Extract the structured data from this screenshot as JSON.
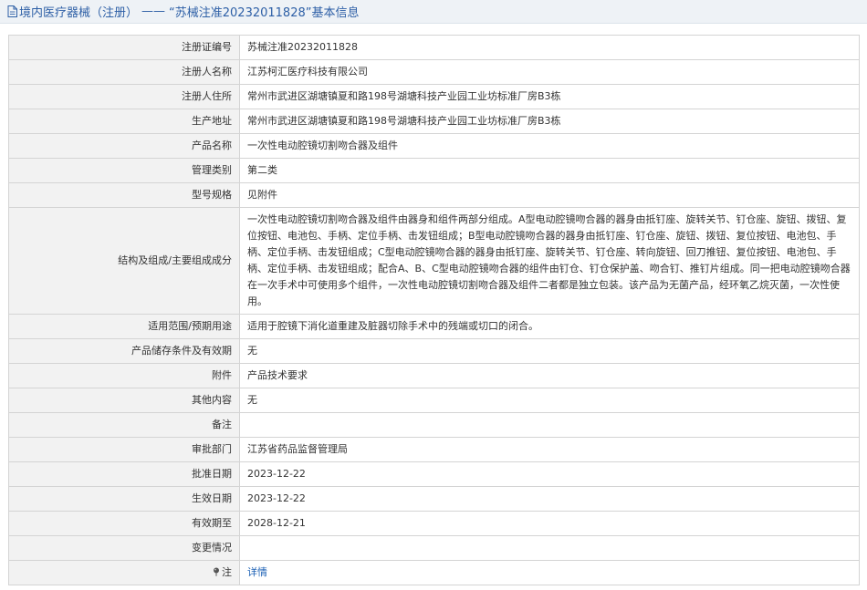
{
  "header": {
    "category": "境内医疗器械（注册）",
    "separator": "——",
    "record_title": "“苏械注准20232011828”基本信息"
  },
  "rows": [
    {
      "label": "注册证编号",
      "value": "苏械注准20232011828"
    },
    {
      "label": "注册人名称",
      "value": "江苏柯汇医疗科技有限公司"
    },
    {
      "label": "注册人住所",
      "value": "常州市武进区湖塘镇夏和路198号湖塘科技产业园工业坊标准厂房B3栋"
    },
    {
      "label": "生产地址",
      "value": "常州市武进区湖塘镇夏和路198号湖塘科技产业园工业坊标准厂房B3栋"
    },
    {
      "label": "产品名称",
      "value": "一次性电动腔镜切割吻合器及组件"
    },
    {
      "label": "管理类别",
      "value": "第二类"
    },
    {
      "label": "型号规格",
      "value": "见附件"
    },
    {
      "label": "结构及组成/主要组成成分",
      "value": "一次性电动腔镜切割吻合器及组件由器身和组件两部分组成。A型电动腔镜吻合器的器身由抵钉座、旋转关节、钉仓座、旋钮、拨钮、复位按钮、电池包、手柄、定位手柄、击发钮组成；B型电动腔镜吻合器的器身由抵钉座、钉仓座、旋钮、拨钮、复位按钮、电池包、手柄、定位手柄、击发钮组成；C型电动腔镜吻合器的器身由抵钉座、旋转关节、钉仓座、转向旋钮、回刀推钮、复位按钮、电池包、手柄、定位手柄、击发钮组成；配合A、B、C型电动腔镜吻合器的组件由钉仓、钉仓保护盖、吻合钉、推钉片组成。同一把电动腔镜吻合器在一次手术中可使用多个组件，一次性电动腔镜切割吻合器及组件二者都是独立包装。该产品为无菌产品，经环氧乙烷灭菌，一次性使用。"
    },
    {
      "label": "适用范围/预期用途",
      "value": "适用于腔镜下消化道重建及脏器切除手术中的残端或切口的闭合。"
    },
    {
      "label": "产品储存条件及有效期",
      "value": "无"
    },
    {
      "label": "附件",
      "value": "产品技术要求"
    },
    {
      "label": "其他内容",
      "value": "无"
    },
    {
      "label": "备注",
      "value": ""
    },
    {
      "label": "审批部门",
      "value": "江苏省药品监督管理局"
    },
    {
      "label": "批准日期",
      "value": "2023-12-22"
    },
    {
      "label": "生效日期",
      "value": "2023-12-22"
    },
    {
      "label": "有效期至",
      "value": "2028-12-21"
    },
    {
      "label": "变更情况",
      "value": ""
    }
  ],
  "note_row": {
    "label": "注",
    "link_text": "详情",
    "icon": "pin-icon"
  },
  "colors": {
    "title_text": "#2d5fa6",
    "title_bg": "#eef2f6",
    "label_bg": "#f2f2f2",
    "border": "#d4d4d4",
    "link": "#1a5fb4"
  }
}
